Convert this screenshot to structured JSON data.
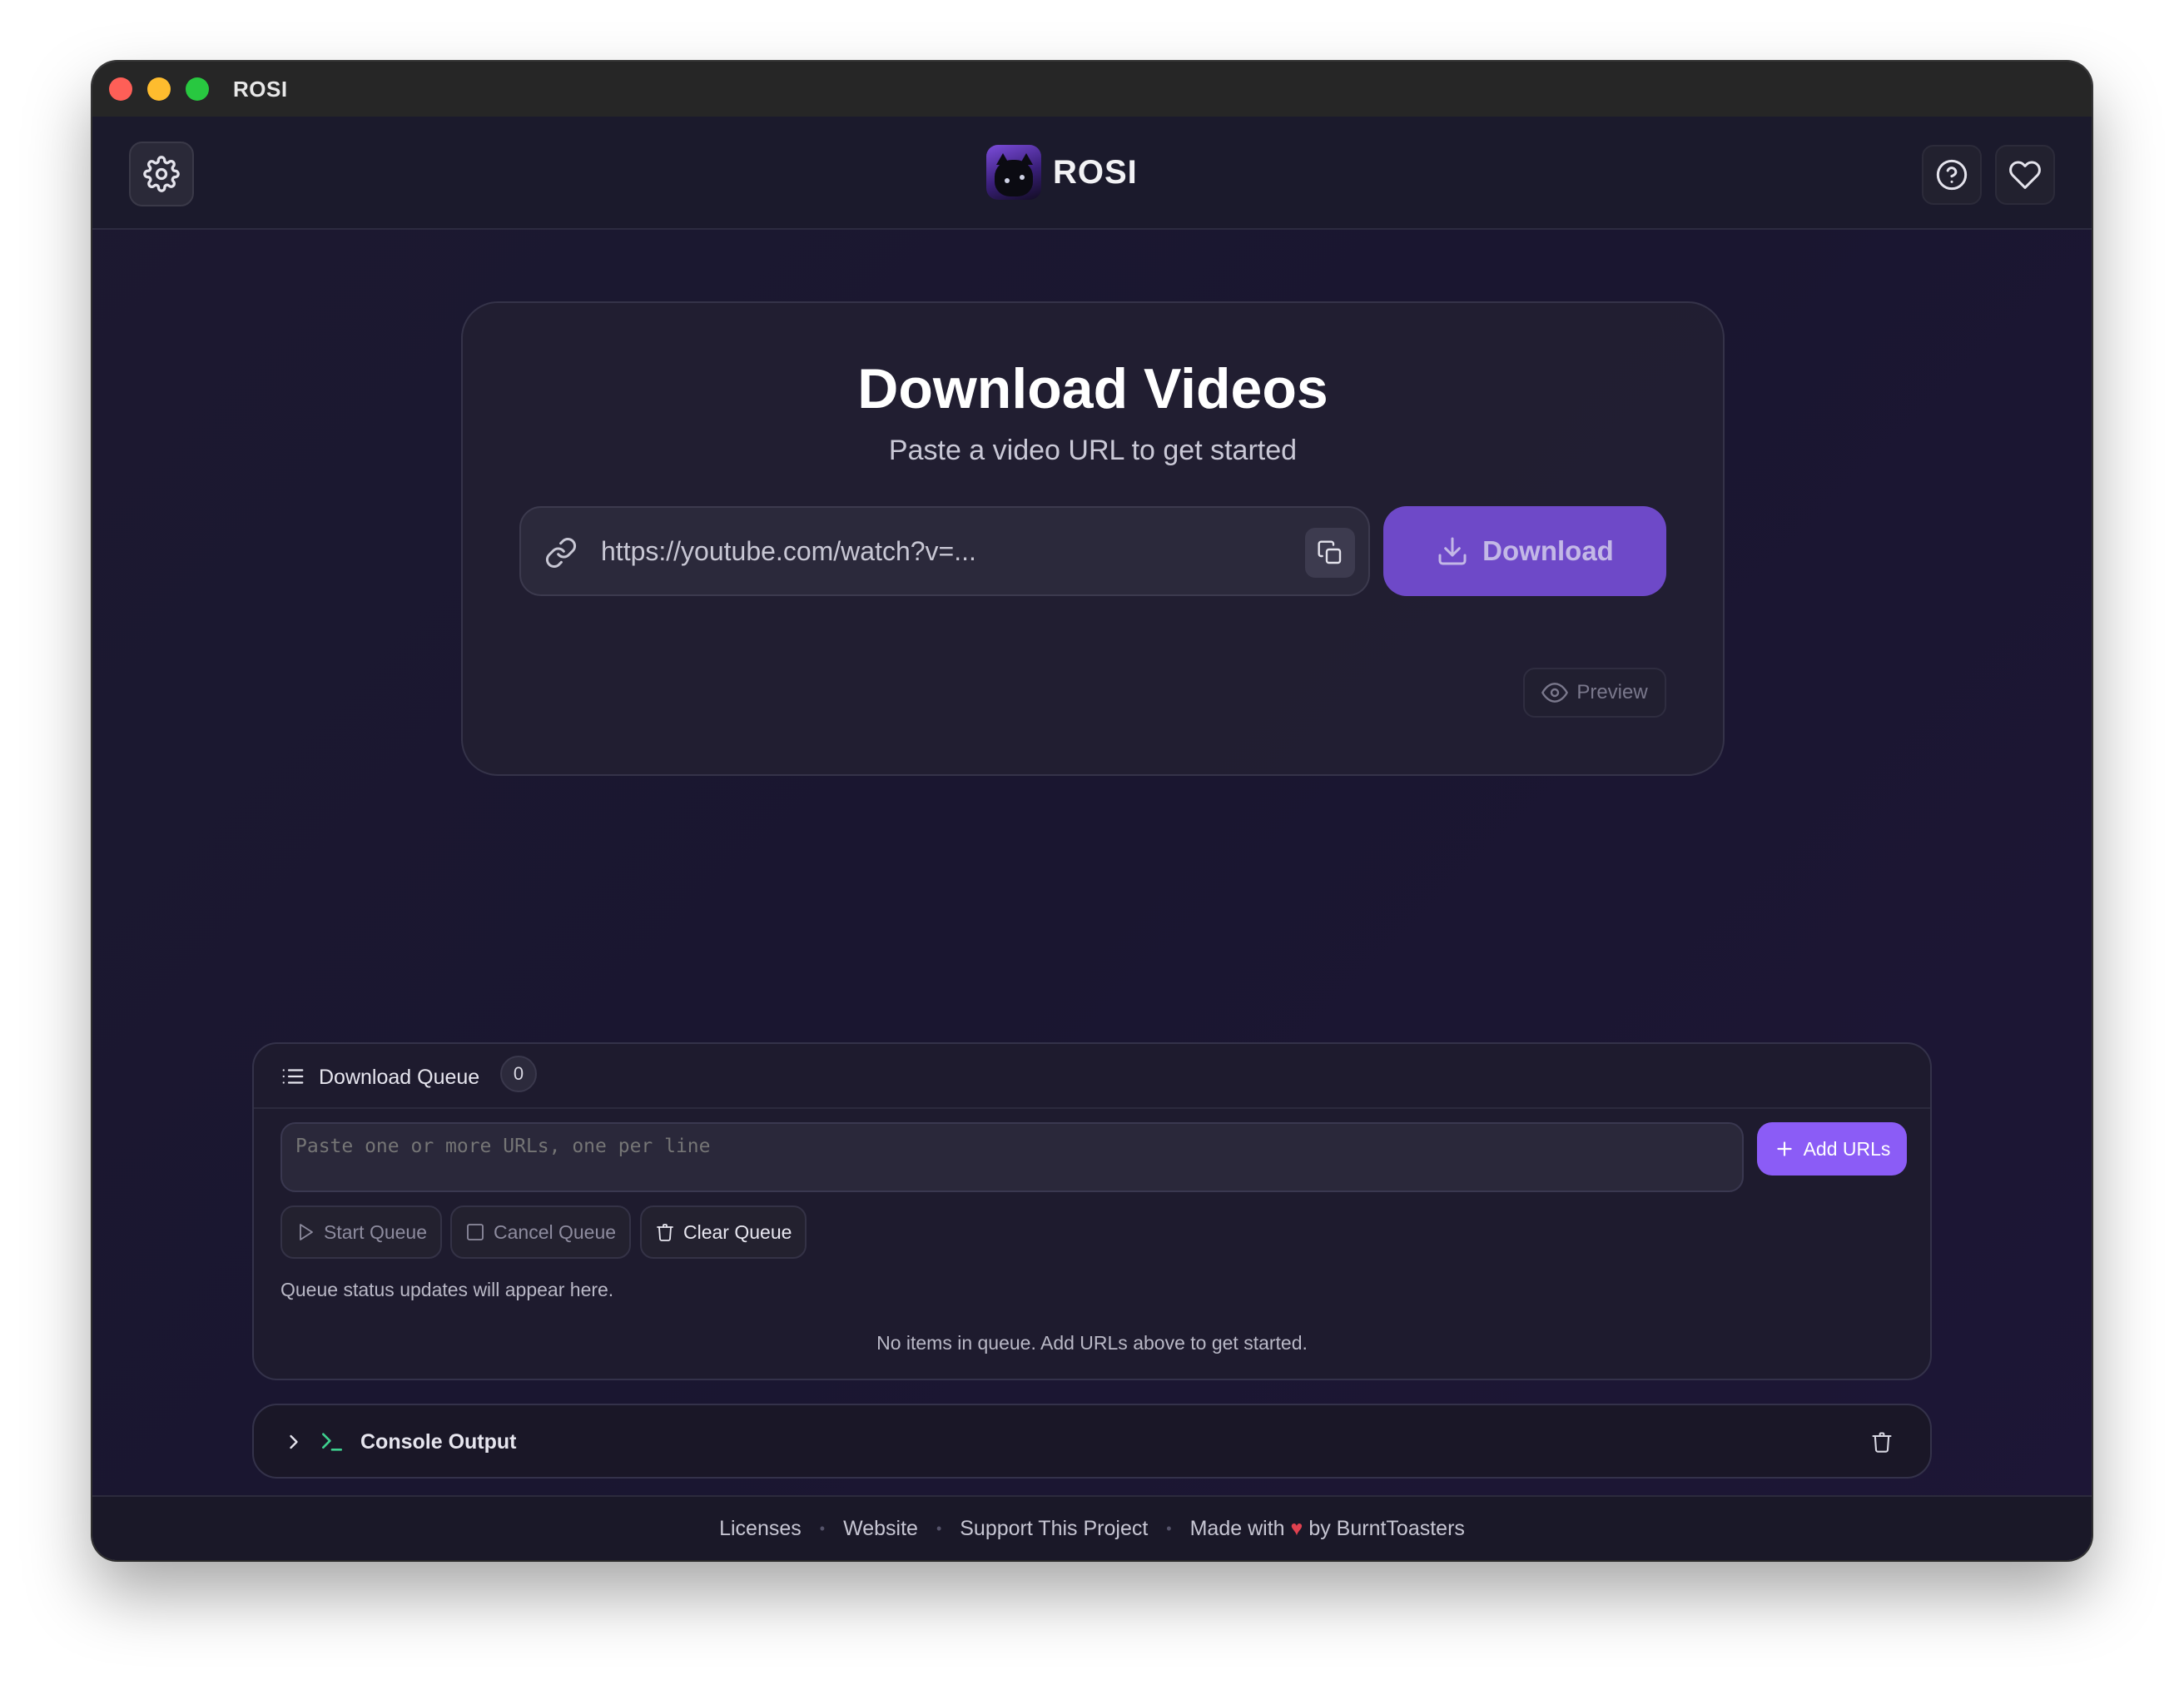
{
  "window": {
    "title": "ROSI"
  },
  "header": {
    "logo_text": "ROSI",
    "settings_icon": "gear-icon",
    "help_icon": "help-circle-icon",
    "heart_icon": "heart-icon"
  },
  "hero": {
    "title": "Download Videos",
    "subtitle": "Paste a video URL to get started",
    "url_placeholder": "https://youtube.com/watch?v=...",
    "download_label": "Download",
    "preview_label": "Preview"
  },
  "queue": {
    "title": "Download Queue",
    "count": "0",
    "urls_placeholder": "Paste one or more URLs, one per line",
    "add_label": "Add URLs",
    "start_label": "Start Queue",
    "cancel_label": "Cancel Queue",
    "clear_label": "Clear Queue",
    "status_text": "Queue status updates will appear here.",
    "empty_text": "No items in queue. Add URLs above to get started."
  },
  "console": {
    "label": "Console Output"
  },
  "footer": {
    "licenses": "Licenses",
    "website": "Website",
    "support": "Support This Project",
    "made_with": "Made with",
    "by": "by BurntToasters"
  },
  "colors": {
    "accent": "#8b5cf6",
    "download_button": "#6e49c8",
    "heart": "#e0414f"
  }
}
